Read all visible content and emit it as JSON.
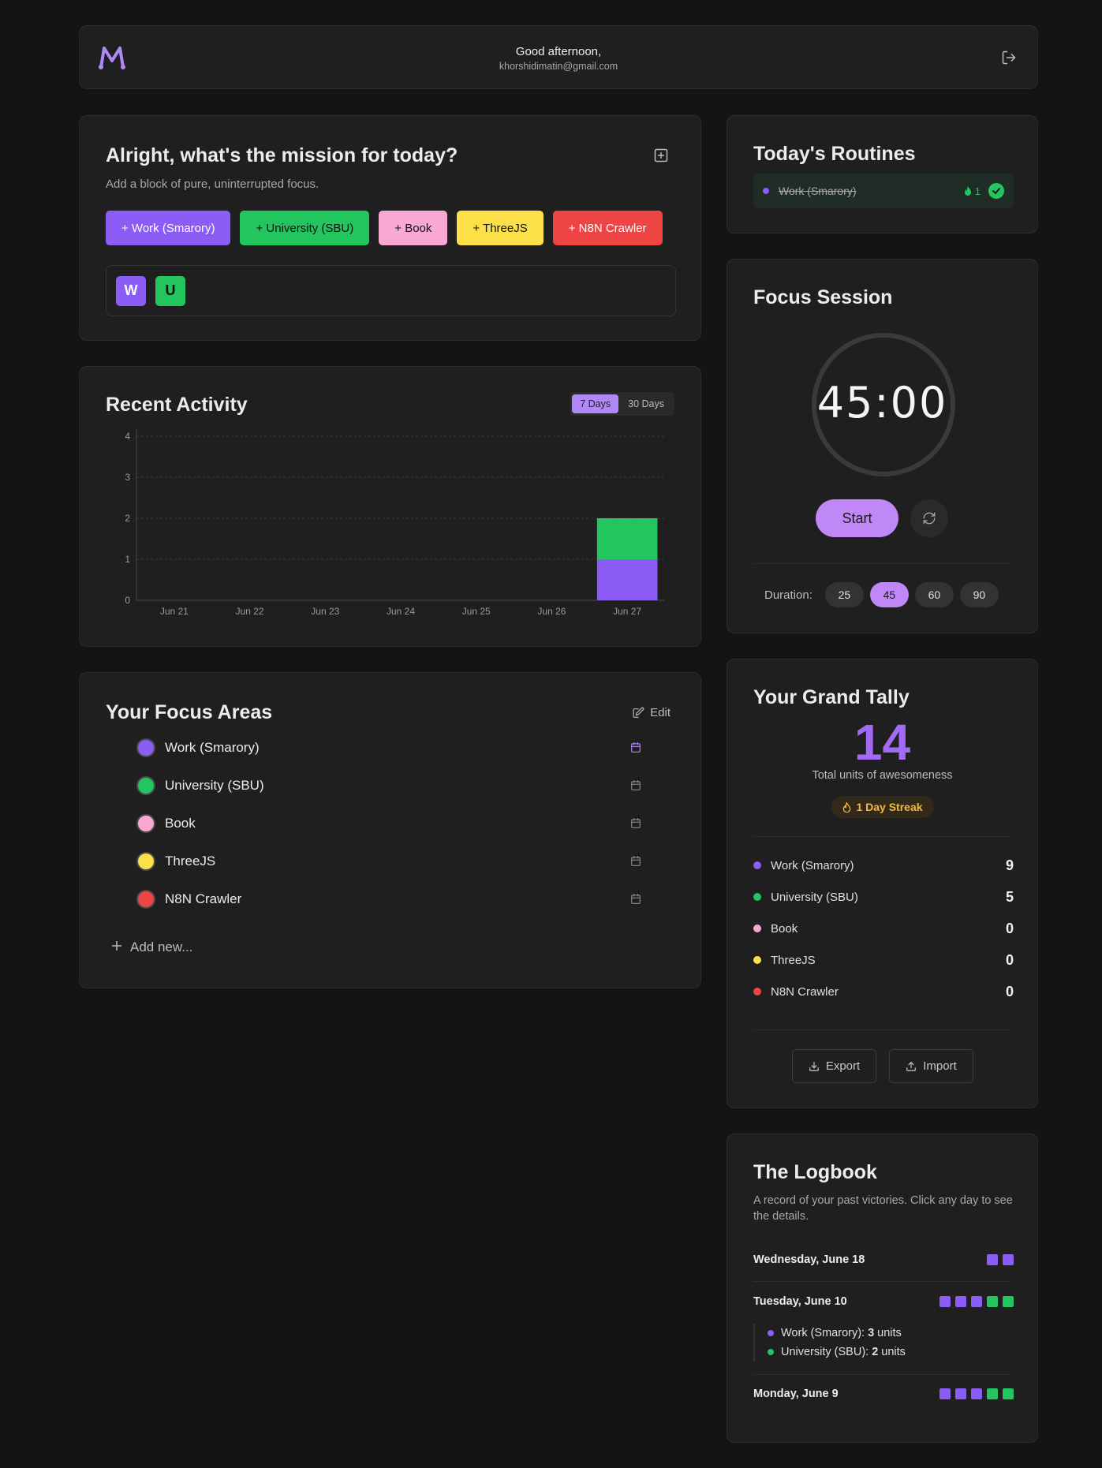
{
  "colors": {
    "purple": "#8b5cf6",
    "green": "#22c55e",
    "pink": "#f9a8d4",
    "yellow": "#fde047",
    "red": "#ef4444",
    "accent": "#c088f7",
    "streak": "#f5b93d"
  },
  "header": {
    "logo_icon": "m-logo-icon",
    "greeting": "Good afternoon,",
    "email": "khorshidimatin@gmail.com",
    "logout_icon": "logout-icon"
  },
  "mission": {
    "title": "Alright, what's the mission for today?",
    "subtitle": "Add a block of pure, uninterrupted focus.",
    "add_icon": "plus-square-icon",
    "quick_buttons": [
      {
        "label": "+ Work (Smarory)",
        "color": "#8b5cf6",
        "text_color": "#ffffff"
      },
      {
        "label": "+ University (SBU)",
        "color": "#22c55e",
        "text_color": "#111111"
      },
      {
        "label": "+ Book",
        "color": "#f9a8d4",
        "text_color": "#111111"
      },
      {
        "label": "+ ThreeJS",
        "color": "#fde047",
        "text_color": "#111111"
      },
      {
        "label": "+ N8N Crawler",
        "color": "#ef4444",
        "text_color": "#ffffff"
      }
    ],
    "chips": [
      {
        "letter": "W",
        "color": "#8b5cf6"
      },
      {
        "letter": "U",
        "color": "#22c55e"
      }
    ]
  },
  "activity": {
    "title": "Recent Activity",
    "range_options": [
      "7 Days",
      "30 Days"
    ],
    "selected_range": "7 Days"
  },
  "chart_data": {
    "type": "bar",
    "stacked": true,
    "categories": [
      "Jun 21",
      "Jun 22",
      "Jun 23",
      "Jun 24",
      "Jun 25",
      "Jun 26",
      "Jun 27"
    ],
    "series": [
      {
        "values": [
          0,
          0,
          0,
          0,
          0,
          0,
          1
        ],
        "color": "#8b5cf6"
      },
      {
        "values": [
          0,
          0,
          0,
          0,
          0,
          0,
          1
        ],
        "color": "#22c55e"
      }
    ],
    "ylim": [
      0,
      4
    ],
    "yticks": [
      0,
      1,
      2,
      3,
      4
    ],
    "grid": true,
    "title": "",
    "xlabel": "",
    "ylabel": ""
  },
  "areas": {
    "title": "Your Focus Areas",
    "edit_label": "Edit",
    "add_label": "Add new...",
    "items": [
      {
        "name": "Work (Smarory)",
        "color": "#8b5cf6",
        "cal_color": "#b288f7"
      },
      {
        "name": "University (SBU)",
        "color": "#22c55e",
        "cal_color": "#8a8a8a"
      },
      {
        "name": "Book",
        "color": "#f9a8d4",
        "cal_color": "#8a8a8a"
      },
      {
        "name": "ThreeJS",
        "color": "#fde047",
        "cal_color": "#8a8a8a"
      },
      {
        "name": "N8N Crawler",
        "color": "#ef4444",
        "cal_color": "#8a8a8a"
      }
    ]
  },
  "routines": {
    "title": "Today's Routines",
    "items": [
      {
        "name": "Work (Smarory)",
        "streak": "1",
        "done": true
      }
    ]
  },
  "session": {
    "title": "Focus Session",
    "timer": "45:00",
    "start_label": "Start",
    "duration_label": "Duration:",
    "durations": [
      "25",
      "45",
      "60",
      "90"
    ],
    "selected_duration": "45"
  },
  "tally": {
    "title": "Your Grand Tally",
    "total": "14",
    "total_label": "Total units of awesomeness",
    "streak_label": "1 Day Streak",
    "rows": [
      {
        "name": "Work (Smarory)",
        "value": "9",
        "color": "#8b5cf6"
      },
      {
        "name": "University (SBU)",
        "value": "5",
        "color": "#22c55e"
      },
      {
        "name": "Book",
        "value": "0",
        "color": "#f9a8d4"
      },
      {
        "name": "ThreeJS",
        "value": "0",
        "color": "#fde047"
      },
      {
        "name": "N8N Crawler",
        "value": "0",
        "color": "#ef4444"
      }
    ],
    "export_label": "Export",
    "import_label": "Import"
  },
  "logbook": {
    "title": "The Logbook",
    "description": "A record of your past victories. Click any day to see the details.",
    "days": [
      {
        "name": "Wednesday, June 18",
        "squares": [
          "#8b5cf6",
          "#8b5cf6"
        ]
      },
      {
        "name": "Tuesday, June 10",
        "squares": [
          "#8b5cf6",
          "#8b5cf6",
          "#8b5cf6",
          "#22c55e",
          "#22c55e"
        ]
      },
      {
        "name": "Monday, June 9",
        "squares": [
          "#8b5cf6",
          "#8b5cf6",
          "#8b5cf6",
          "#22c55e",
          "#22c55e"
        ]
      }
    ],
    "detail": [
      {
        "name": "Work (Smarory):",
        "units": "3",
        "suffix": "units",
        "color": "#8b5cf6"
      },
      {
        "name": "University (SBU):",
        "units": "2",
        "suffix": "units",
        "color": "#22c55e"
      }
    ]
  }
}
